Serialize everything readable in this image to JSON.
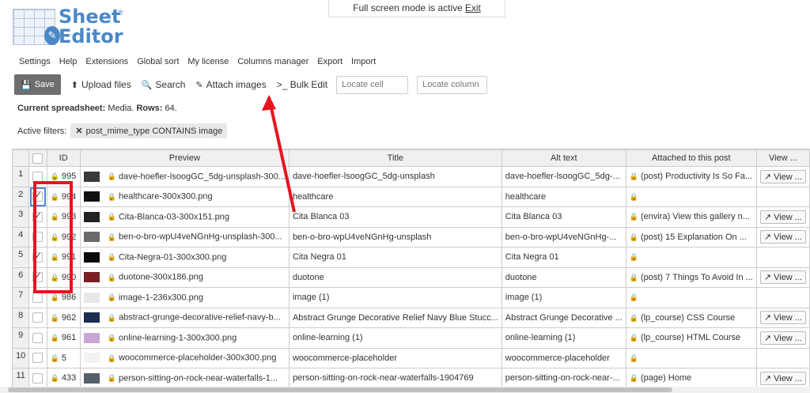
{
  "banner": {
    "text": "Full screen mode is active",
    "exit": "Exit"
  },
  "logo": {
    "line1": "Sheet",
    "line2": "Editor",
    "reg": "®"
  },
  "menu": [
    "Settings",
    "Help",
    "Extensions",
    "Global sort",
    "My license",
    "Columns manager",
    "Export",
    "Import"
  ],
  "toolbar": {
    "save": "Save",
    "upload": "Upload files",
    "search": "Search",
    "attach": "Attach images",
    "bulk_edit": ">_ Bulk Edit",
    "locate_cell": "Locate cell",
    "locate_column": "Locate column"
  },
  "current": {
    "label": "Current spreadsheet:",
    "name": "Media.",
    "rows_label": "Rows:",
    "rows": "64."
  },
  "filters": {
    "label": "Active filters:",
    "chip": "post_mime_type CONTAINS image"
  },
  "columns": [
    "",
    "ID",
    "Preview",
    "Title",
    "Alt text",
    "Attached to this post",
    "View ..."
  ],
  "rows": [
    {
      "n": "1",
      "checked": false,
      "id": "995",
      "preview": "dave-hoefler-lsoogGC_5dg-unsplash-300...",
      "title": "dave-hoefler-lsoogGC_5dg-unsplash",
      "alt": "dave-hoefler-lsoogGC_5dg-...",
      "attached": "(post) Productivity Is So Fa...",
      "view": "View ...",
      "thumb": "#3a3a3a"
    },
    {
      "n": "2",
      "checked": true,
      "id": "994",
      "preview": "healthcare-300x300.png",
      "title": "healthcare",
      "alt": "healthcare",
      "attached": "",
      "view": "",
      "thumb": "#111111"
    },
    {
      "n": "3",
      "checked": true,
      "id": "993",
      "preview": "Cita-Blanca-03-300x151.png",
      "title": "Cita Blanca 03",
      "alt": "Cita Blanca 03",
      "attached": "(envira) View this gallery n...",
      "view": "View ...",
      "thumb": "#222222"
    },
    {
      "n": "4",
      "checked": false,
      "id": "992",
      "preview": "ben-o-bro-wpU4veNGnHg-unsplash-300...",
      "title": "ben-o-bro-wpU4veNGnHg-unsplash",
      "alt": "ben-o-bro-wpU4veNGnHg-...",
      "attached": "(post) 15 Explanation On ...",
      "view": "View ...",
      "thumb": "#6a6a6a"
    },
    {
      "n": "5",
      "checked": true,
      "id": "991",
      "preview": "Cita-Negra-01-300x300.png",
      "title": "Cita Negra 01",
      "alt": "Cita Negra 01",
      "attached": "",
      "view": "",
      "thumb": "#0a0a0a"
    },
    {
      "n": "6",
      "checked": true,
      "id": "990",
      "preview": "duotone-300x186.png",
      "title": "duotone",
      "alt": "duotone",
      "attached": "(post) 7 Things To Avoid In ...",
      "view": "View ...",
      "thumb": "#7a1f24"
    },
    {
      "n": "7",
      "checked": false,
      "id": "986",
      "preview": "image-1-236x300.png",
      "title": "image (1)",
      "alt": "image (1)",
      "attached": "",
      "view": "",
      "thumb": "#e8e8e8"
    },
    {
      "n": "8",
      "checked": false,
      "id": "962",
      "preview": "abstract-grunge-decorative-relief-navy-b...",
      "title": "Abstract Grunge Decorative Relief Navy Blue Stucc...",
      "alt": "Abstract Grunge Decorative ...",
      "attached": "(lp_course) CSS Course",
      "view": "View ...",
      "thumb": "#1d2c52"
    },
    {
      "n": "9",
      "checked": false,
      "id": "961",
      "preview": "online-learning-1-300x300.png",
      "title": "online-learning (1)",
      "alt": "online-learning (1)",
      "attached": "(lp_course) HTML Course",
      "view": "View ...",
      "thumb": "#c9a6d6"
    },
    {
      "n": "10",
      "checked": false,
      "id": "5",
      "preview": "woocommerce-placeholder-300x300.png",
      "title": "woocommerce-placeholder",
      "alt": "woocommerce-placeholder",
      "attached": "",
      "view": "",
      "thumb": "#f2f2f2"
    },
    {
      "n": "11",
      "checked": false,
      "id": "433",
      "preview": "person-sitting-on-rock-near-waterfalls-1...",
      "title": "person-sitting-on-rock-near-waterfalls-1904769",
      "alt": "person-sitting-on-rock-near-...",
      "attached": "(page) Home",
      "view": "View ...",
      "thumb": "#55606a"
    }
  ],
  "colors": {
    "accent": "#4a88c7",
    "annotation": "#e8141f",
    "save_bg": "#6d6e70"
  }
}
